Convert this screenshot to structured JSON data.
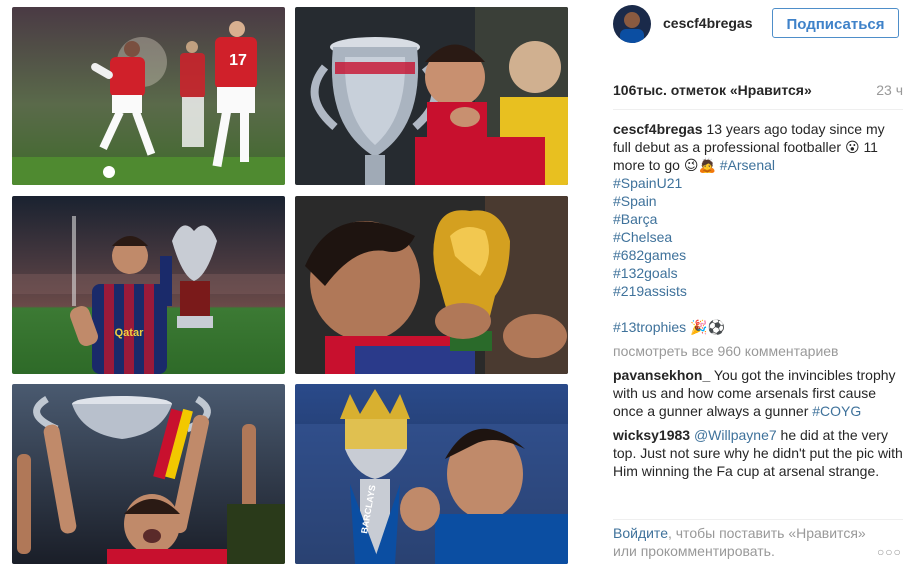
{
  "post": {
    "username": "cescf4bregas",
    "follow_label": "Подписаться",
    "likes": "106тыс. отметок «Нравится»",
    "time": "23 ч",
    "caption": {
      "author": "cescf4bregas",
      "text_1": "13 years ago today since my full debut as a professional footballer",
      "text_2": "11 more to go",
      "tags": [
        "#Arsenal",
        "#SpainU21",
        "#Spain",
        "#Barça",
        "#Chelsea",
        "#682games",
        "#132goals",
        "#219assists",
        "#13trophies"
      ]
    },
    "view_all": "посмотреть все 960 комментариев",
    "comments": [
      {
        "author": "pavansekhon_",
        "text": "You got the invincibles trophy with us and how come arsenals first cause once a gunner always a gunner",
        "tag": "#COYG"
      },
      {
        "author": "wicksy1983",
        "mention": "@Willpayne7",
        "text": "he did at the very top. Just not sure why he didn't put the pic with Him winning the Fa cup at arsenal strange."
      }
    ],
    "footer": {
      "login": "Войдите",
      "rest": ", чтобы поставить «Нравится» или прокомментировать."
    }
  },
  "photos": {
    "tiles": [
      {
        "name": "photo-arsenal-match",
        "colors": {
          "bg": "#3a4a2a",
          "shirt": "#d0202a"
        }
      },
      {
        "name": "photo-euro-trophy-spain",
        "colors": {
          "bg": "#2a2a30",
          "shirt": "#c8102e"
        }
      },
      {
        "name": "photo-barca-supercup",
        "colors": {
          "bg": "#1a2a3a",
          "shirt": "#8b1a3a"
        }
      },
      {
        "name": "photo-world-cup-kiss",
        "colors": {
          "bg": "#222222",
          "shirt": "#c8102e"
        }
      },
      {
        "name": "photo-euro-trophy-lift",
        "colors": {
          "bg": "#2a3040",
          "shirt": "#c8102e"
        }
      },
      {
        "name": "photo-premier-league-trophy",
        "colors": {
          "bg": "#1a2b4a",
          "shirt": "#0b4ea2"
        }
      }
    ]
  },
  "colors": {
    "link": "#3f729b",
    "muted": "#999999",
    "follow_border": "#4e8ec9"
  }
}
